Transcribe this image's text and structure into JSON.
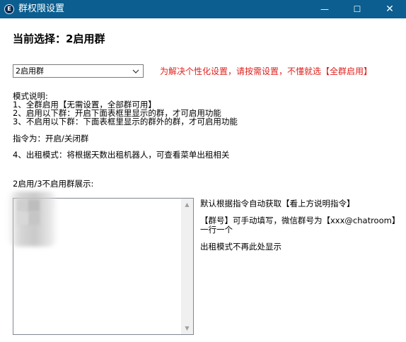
{
  "window": {
    "title": "群权限设置",
    "min_glyph": "—",
    "max_glyph": "☐",
    "close_glyph": "✕"
  },
  "current_selection": "当前选择：2启用群",
  "mode_select": {
    "value": "2启用群"
  },
  "hint": "为解决个性化设置，请按需设置，不懂就选【全群启用】",
  "mode_description": {
    "heading": "模式说明:",
    "line1": "1、全群启用【无需设置，全部群可用】",
    "line2": "2、启用以下群：开启下面表框里显示的群，才可启用功能",
    "line3": "3、不启用以下群：下面表框里显示的群外的群，才可启用功能",
    "command": "指令为：开启/关闭群",
    "line4": "4、出租模式：将根据天数出租机器人，可查看菜单出租相关"
  },
  "list_label": "2启用/3不启用群展示:",
  "right_notes": {
    "note1": "默认根据指令自动获取【看上方说明指令】",
    "note2a": "【群号】可手动填写，微信群号为【xxx@chatroom】",
    "note2b": "一行一个",
    "note3": "出租模式不再此处显示"
  },
  "colors": {
    "titlebar": "#0b5e8f",
    "hint_red": "#e0201c"
  },
  "icons": {
    "app": "app-logo-icon",
    "dropdown": "chevron-down-icon",
    "scroll_up": "scroll-up-arrow-icon",
    "scroll_down": "scroll-down-arrow-icon"
  }
}
